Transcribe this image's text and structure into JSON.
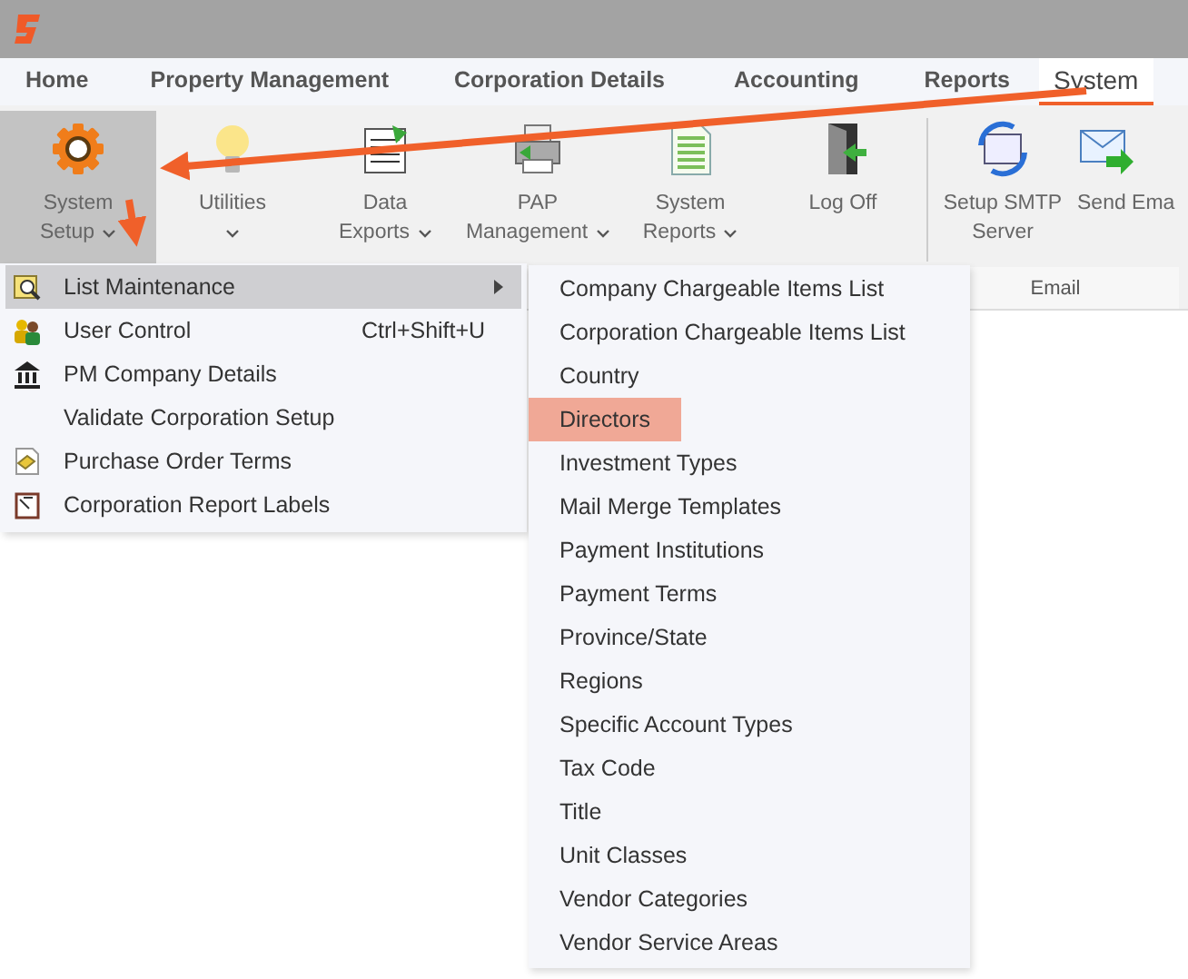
{
  "tabs": [
    {
      "label": "Home",
      "selected": false
    },
    {
      "label": "Property Management",
      "selected": false
    },
    {
      "label": "Corporation Details",
      "selected": false
    },
    {
      "label": "Accounting",
      "selected": false
    },
    {
      "label": "Reports",
      "selected": false
    },
    {
      "label": "System",
      "selected": true
    }
  ],
  "ribbon": {
    "groups": [
      {
        "buttons": [
          {
            "kind": "gear",
            "lines": [
              "System",
              "Setup"
            ],
            "dropdown": true,
            "selected": true
          },
          {
            "kind": "bulb",
            "lines": [
              "Utilities"
            ],
            "dropdown": true,
            "selected": false
          },
          {
            "kind": "document",
            "lines": [
              "Data",
              "Exports"
            ],
            "dropdown": true,
            "selected": false
          },
          {
            "kind": "printer",
            "lines": [
              "PAP",
              "Management"
            ],
            "dropdown": true,
            "selected": false
          },
          {
            "kind": "sheet",
            "lines": [
              "System",
              "Reports"
            ],
            "dropdown": true,
            "selected": false
          },
          {
            "kind": "door",
            "lines": [
              "Log Off"
            ],
            "dropdown": false,
            "selected": false
          }
        ]
      },
      {
        "label": "Email",
        "buttons": [
          {
            "kind": "sync",
            "lines": [
              "Setup SMTP",
              "Server"
            ],
            "dropdown": false,
            "selected": false
          },
          {
            "kind": "mail",
            "lines": [
              "Send Ema"
            ],
            "dropdown": false,
            "selected": false
          }
        ]
      }
    ]
  },
  "menu": {
    "items": [
      {
        "kind": "magnifier",
        "label": "List Maintenance",
        "submenu": true,
        "selected": true
      },
      {
        "kind": "users",
        "label": "User Control",
        "shortcut": "Ctrl+Shift+U",
        "submenu": false,
        "selected": false
      },
      {
        "kind": "bank",
        "label": "PM Company Details",
        "submenu": false,
        "selected": false
      },
      {
        "kind": "plain",
        "label": "Validate Corporation Setup",
        "submenu": false,
        "selected": false
      },
      {
        "kind": "note",
        "label": "Purchase Order Terms",
        "submenu": false,
        "selected": false
      },
      {
        "kind": "clipboard",
        "label": "Corporation Report Labels",
        "submenu": false,
        "selected": false
      }
    ]
  },
  "submenu": {
    "items": [
      {
        "label": "Company Chargeable Items List",
        "selected": false
      },
      {
        "label": "Corporation Chargeable Items List",
        "selected": false
      },
      {
        "label": "Country",
        "selected": false
      },
      {
        "label": "Directors",
        "selected": true
      },
      {
        "label": "Investment Types",
        "selected": false
      },
      {
        "label": "Mail Merge Templates",
        "selected": false
      },
      {
        "label": "Payment Institutions",
        "selected": false
      },
      {
        "label": "Payment Terms",
        "selected": false
      },
      {
        "label": "Province/State",
        "selected": false
      },
      {
        "label": "Regions",
        "selected": false
      },
      {
        "label": "Specific Account Types",
        "selected": false
      },
      {
        "label": "Tax Code",
        "selected": false
      },
      {
        "label": "Title",
        "selected": false
      },
      {
        "label": "Unit Classes",
        "selected": false
      },
      {
        "label": "Vendor Categories",
        "selected": false
      },
      {
        "label": "Vendor Service Areas",
        "selected": false
      }
    ]
  }
}
